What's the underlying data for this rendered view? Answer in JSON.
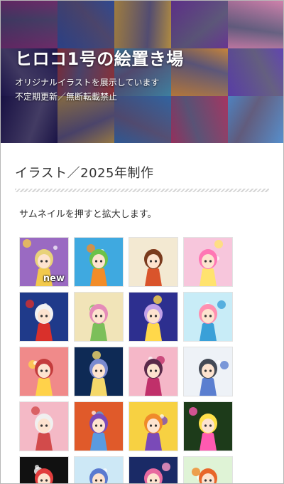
{
  "header": {
    "title": "ヒロコ1号の絵置き場",
    "subtitle_line1": "オリジナルイラストを展示しています",
    "subtitle_line2": "不定期更新／無断転載禁止"
  },
  "section": {
    "title": "イラスト／2025年制作",
    "hint": "サムネイルを押すと拡大します。"
  },
  "gallery": {
    "new_badge": "new",
    "thumbnails": [
      {
        "bg": "#9a6ac2",
        "accent": "#f2c94c",
        "hair": "#e8d27a",
        "badge": true
      },
      {
        "bg": "#3fa9e0",
        "accent": "#f28c28",
        "hair": "#6cc24a"
      },
      {
        "bg": "#f3e9d2",
        "accent": "#d9542b",
        "hair": "#7a3b1e"
      },
      {
        "bg": "#f7c6dc",
        "accent": "#ffe36e",
        "hair": "#ff77b4"
      },
      {
        "bg": "#1f3a8a",
        "accent": "#d9302b",
        "hair": "#f2f2f2"
      },
      {
        "bg": "#f1e4b8",
        "accent": "#7cbf5a",
        "hair": "#e58bb8"
      },
      {
        "bg": "#2d2f8f",
        "accent": "#ffd84a",
        "hair": "#c1a0e8"
      },
      {
        "bg": "#c8ecf7",
        "accent": "#3aa0d8",
        "hair": "#ff8fb0"
      },
      {
        "bg": "#f08a8a",
        "accent": "#ffd24a",
        "hair": "#c43c3c"
      },
      {
        "bg": "#0e2a55",
        "accent": "#f5d86a",
        "hair": "#7a8ad0"
      },
      {
        "bg": "#f5b7c8",
        "accent": "#c0306a",
        "hair": "#5a2a4a"
      },
      {
        "bg": "#eef2f7",
        "accent": "#5b7fd0",
        "hair": "#444a55"
      },
      {
        "bg": "#f4b9c6",
        "accent": "#d24b4b",
        "hair": "#f0f0f0"
      },
      {
        "bg": "#e05a2a",
        "accent": "#5a9be0",
        "hair": "#7a4ab8"
      },
      {
        "bg": "#f7d142",
        "accent": "#7a4ab8",
        "hair": "#f08a2a"
      },
      {
        "bg": "#1d3b1a",
        "accent": "#ff5ab0",
        "hair": "#ffe14a"
      },
      {
        "bg": "#111111",
        "accent": "#ffffff",
        "hair": "#e23d3d"
      },
      {
        "bg": "#cde8f6",
        "accent": "#ff7aa8",
        "hair": "#5a7ad0"
      },
      {
        "bg": "#1a2a66",
        "accent": "#ff9ac8",
        "hair": "#e86aa0"
      },
      {
        "bg": "#dff3d6",
        "accent": "#f08a2a",
        "hair": "#e8662a"
      }
    ]
  },
  "hero_mosaic": [
    "#b84a8f",
    "#3f6fc4",
    "#f0c043",
    "#7b3fa6",
    "#e58fb8",
    "#26215a",
    "#d7452f",
    "#4fb0c8",
    "#f2a23a",
    "#6a4ac0",
    "#1f1b4d",
    "#e7bd48",
    "#3d88c9",
    "#c9406a",
    "#5da0e0"
  ]
}
